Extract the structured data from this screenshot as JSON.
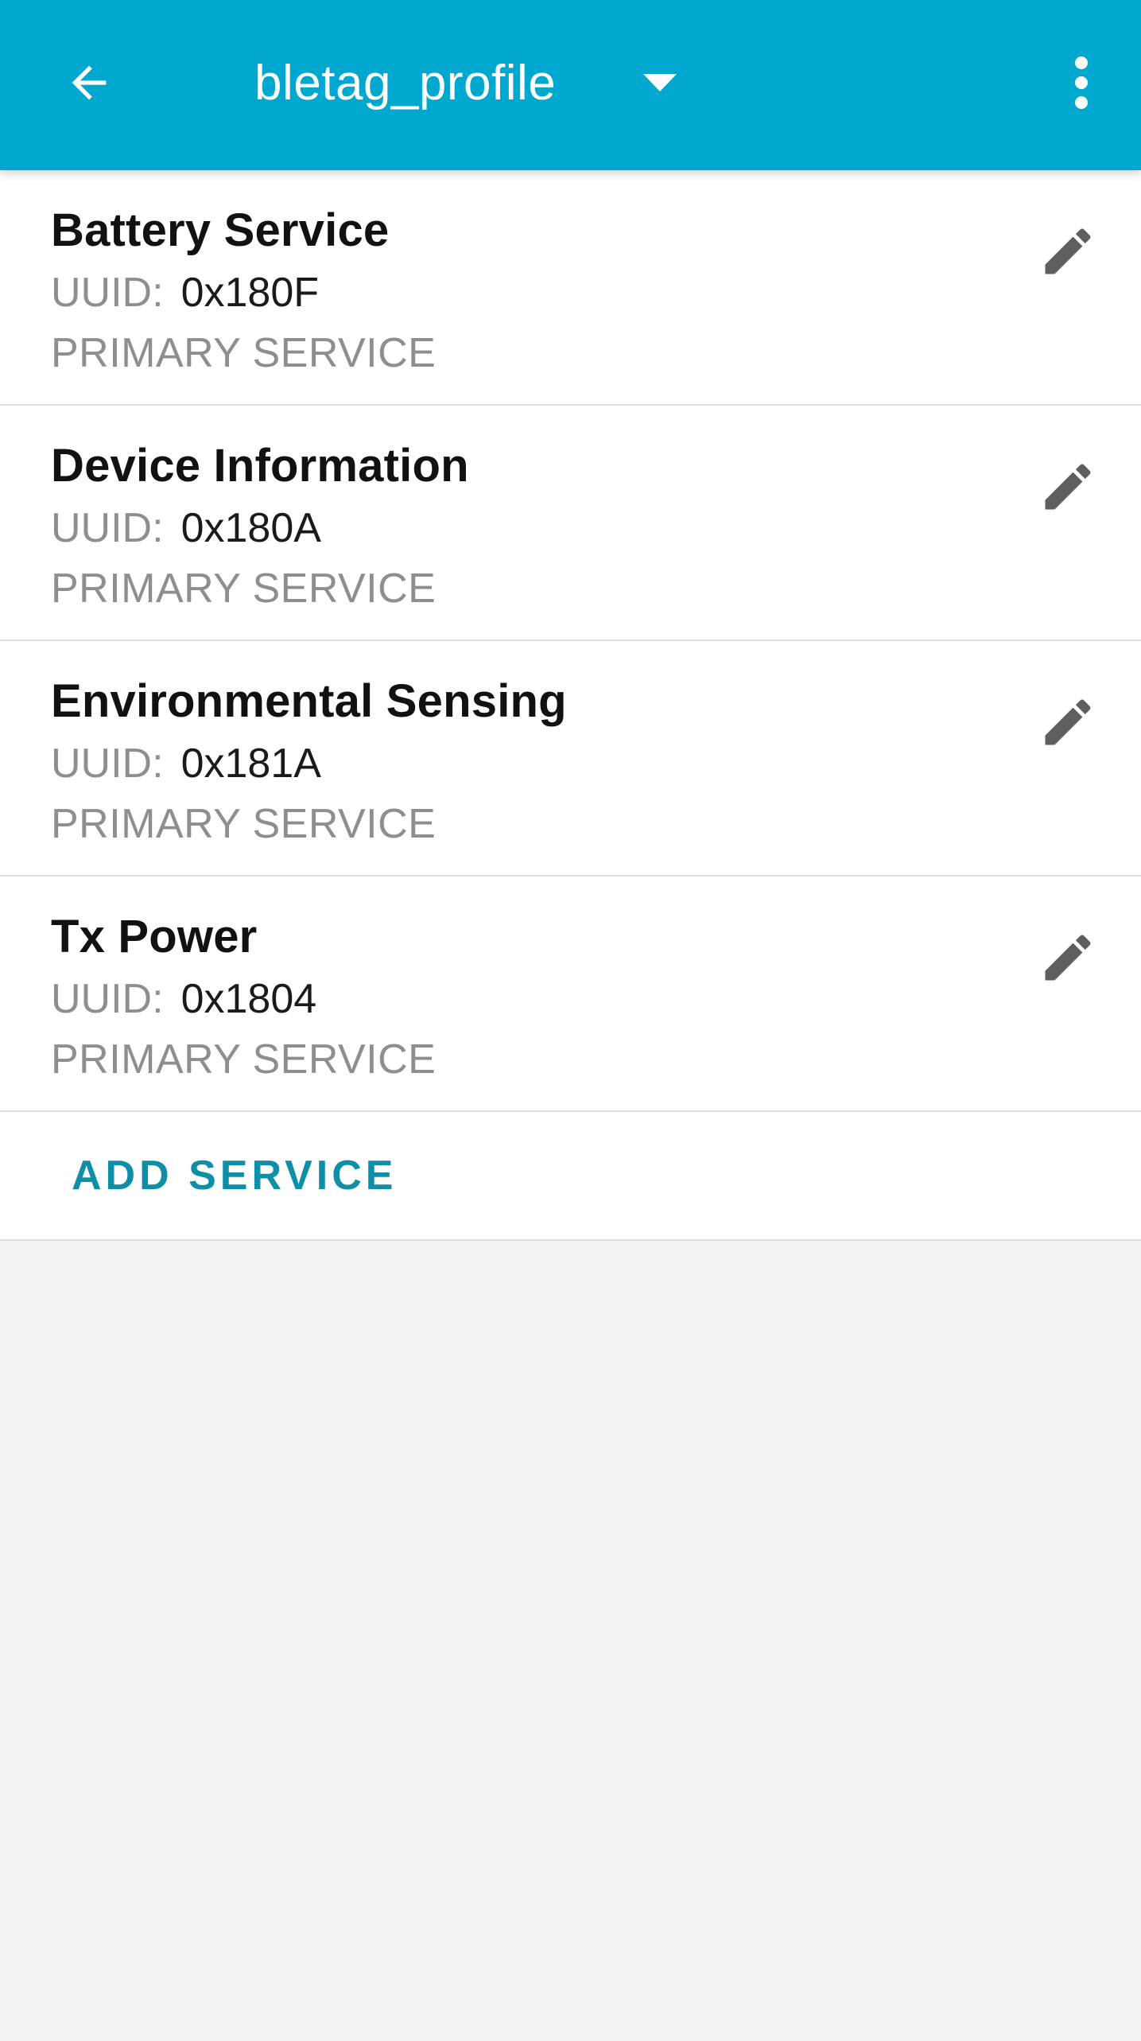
{
  "toolbar": {
    "title": "bletag_profile",
    "back_icon": "arrow-back-icon",
    "dropdown_icon": "caret-down-icon",
    "more_icon": "more-vert-icon"
  },
  "services": [
    {
      "name": "Battery Service",
      "uuid_label": "UUID:",
      "uuid": "0x180F",
      "type": "PRIMARY SERVICE"
    },
    {
      "name": "Device Information",
      "uuid_label": "UUID:",
      "uuid": "0x180A",
      "type": "PRIMARY SERVICE"
    },
    {
      "name": "Environmental Sensing",
      "uuid_label": "UUID:",
      "uuid": "0x181A",
      "type": "PRIMARY SERVICE"
    },
    {
      "name": "Tx Power",
      "uuid_label": "UUID:",
      "uuid": "0x1804",
      "type": "PRIMARY SERVICE"
    }
  ],
  "add_service_label": "ADD SERVICE",
  "colors": {
    "toolbar": "#00a8cf",
    "accent": "#0f8ea8",
    "background": "#f3f3f3",
    "edit_icon": "#5f5f5f"
  }
}
